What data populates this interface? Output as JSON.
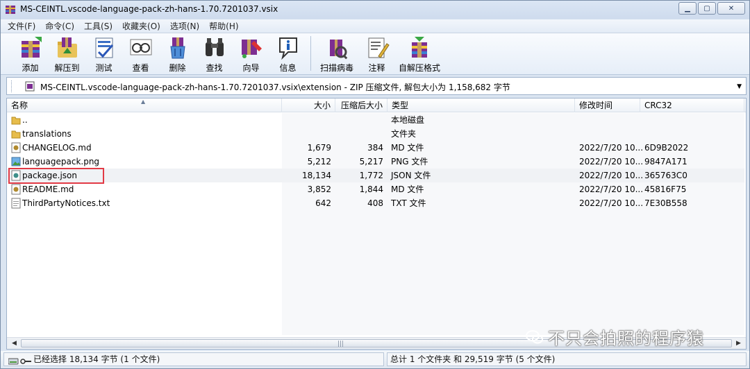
{
  "window": {
    "title": "MS-CEINTL.vscode-language-pack-zh-hans-1.70.7201037.vsix",
    "minimize_icon": "minimize-icon",
    "maximize_icon": "maximize-icon",
    "close_icon": "close-icon"
  },
  "menu": [
    "文件(F)",
    "命令(C)",
    "工具(S)",
    "收藏夹(O)",
    "选项(N)",
    "帮助(H)"
  ],
  "toolbar": [
    {
      "label": "添加",
      "icon": "add-archive-icon"
    },
    {
      "label": "解压到",
      "icon": "extract-to-icon"
    },
    {
      "label": "测试",
      "icon": "test-icon"
    },
    {
      "label": "查看",
      "icon": "view-icon"
    },
    {
      "label": "删除",
      "icon": "delete-icon"
    },
    {
      "label": "查找",
      "icon": "find-icon"
    },
    {
      "label": "向导",
      "icon": "wizard-icon"
    },
    {
      "label": "信息",
      "icon": "info-icon"
    },
    {
      "label": "扫描病毒",
      "icon": "virus-scan-icon"
    },
    {
      "label": "注释",
      "icon": "comment-icon"
    },
    {
      "label": "自解压格式",
      "icon": "sfx-icon"
    }
  ],
  "address": {
    "path": "MS-CEINTL.vscode-language-pack-zh-hans-1.70.7201037.vsix\\extension - ZIP 压缩文件, 解包大小为 1,158,682 字节"
  },
  "columns": {
    "name": "名称",
    "size": "大小",
    "packed": "压缩后大小",
    "type": "类型",
    "modified": "修改时间",
    "crc": "CRC32"
  },
  "files": [
    {
      "name": "..",
      "size": "",
      "packed": "",
      "type": "本地磁盘",
      "modified": "",
      "crc": "",
      "icon": "folder-up-icon"
    },
    {
      "name": "translations",
      "size": "",
      "packed": "",
      "type": "文件夹",
      "modified": "",
      "crc": "",
      "icon": "folder-icon"
    },
    {
      "name": "CHANGELOG.md",
      "size": "1,679",
      "packed": "384",
      "type": "MD 文件",
      "modified": "2022/7/20 10...",
      "crc": "6D9B2022",
      "icon": "md-file-icon"
    },
    {
      "name": "languagepack.png",
      "size": "5,212",
      "packed": "5,217",
      "type": "PNG 文件",
      "modified": "2022/7/20 10...",
      "crc": "9847A171",
      "icon": "png-file-icon"
    },
    {
      "name": "package.json",
      "size": "18,134",
      "packed": "1,772",
      "type": "JSON 文件",
      "modified": "2022/7/20 10...",
      "crc": "365763C0",
      "icon": "json-file-icon"
    },
    {
      "name": "README.md",
      "size": "3,852",
      "packed": "1,844",
      "type": "MD 文件",
      "modified": "2022/7/20 10...",
      "crc": "45816F75",
      "icon": "md-file-icon"
    },
    {
      "name": "ThirdPartyNotices.txt",
      "size": "642",
      "packed": "408",
      "type": "TXT 文件",
      "modified": "2022/7/20 10...",
      "crc": "7E30B558",
      "icon": "txt-file-icon"
    }
  ],
  "status": {
    "left": "已经选择 18,134 字节 (1 个文件)",
    "right": "总计 1 个文件夹 和 29,519 字节 (5 个文件)"
  },
  "watermark": "不只会拍照的程序猿"
}
